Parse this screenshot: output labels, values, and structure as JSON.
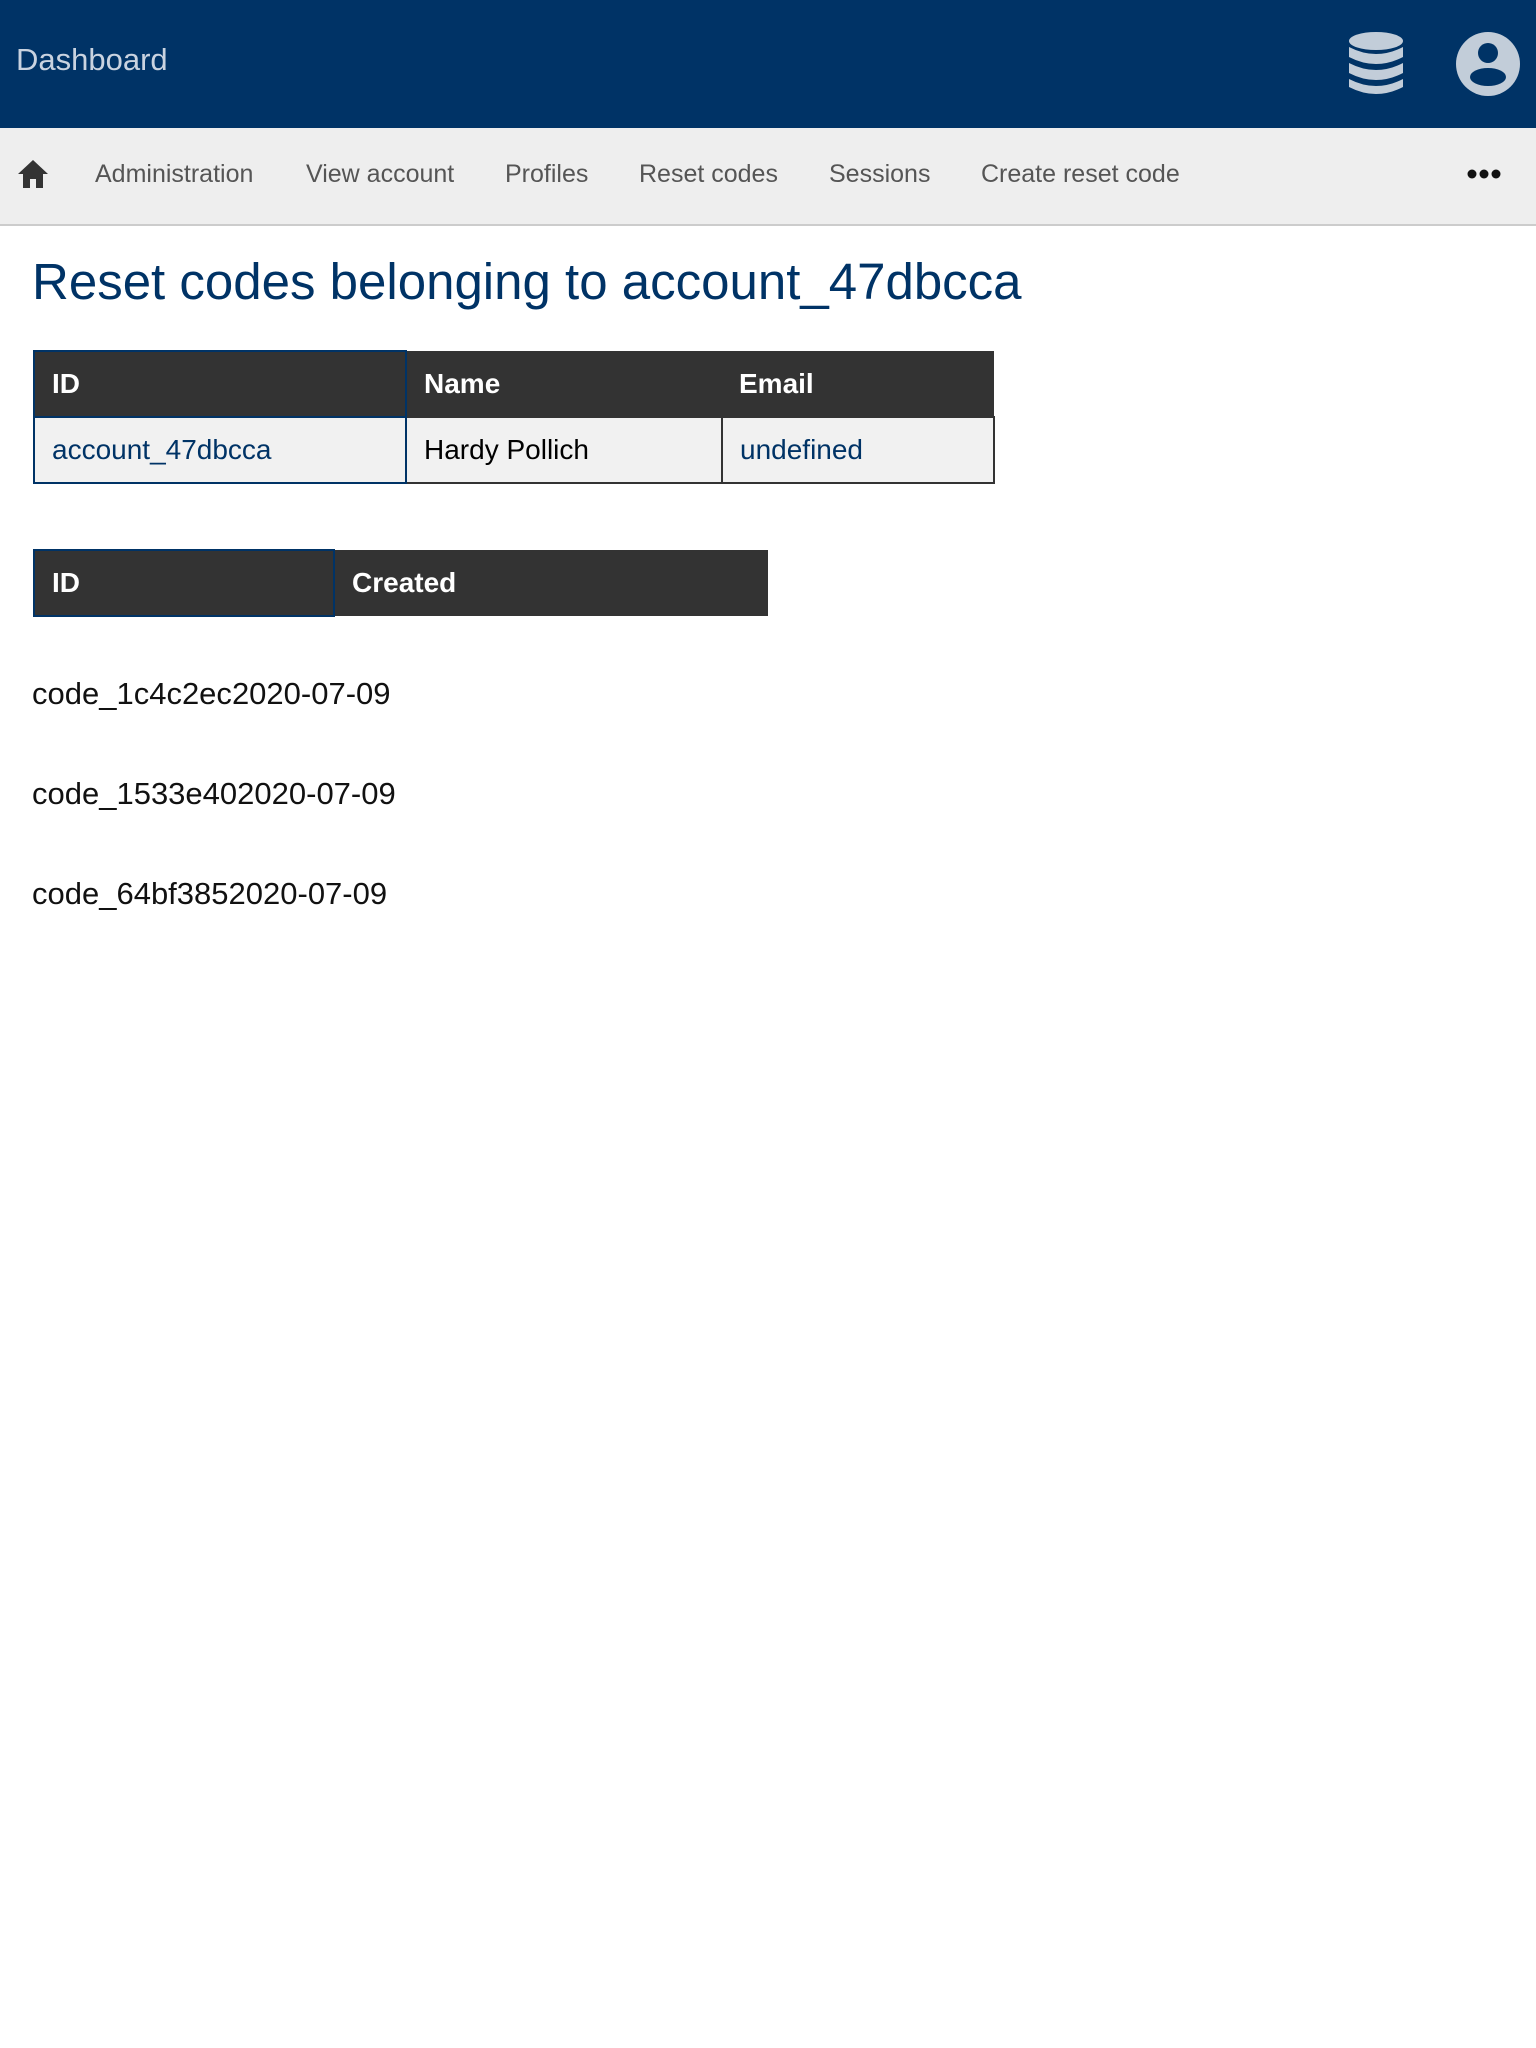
{
  "header": {
    "title": "Dashboard",
    "icons": [
      "database-icon",
      "user-circle-icon"
    ],
    "background": "#003366"
  },
  "nav": {
    "items": [
      {
        "label": "Administration",
        "x": 95
      },
      {
        "label": "View account"
      },
      {
        "label": "Profiles"
      },
      {
        "label": "Reset codes"
      },
      {
        "label": "Sessions"
      },
      {
        "label": "Create reset code"
      }
    ]
  },
  "page": {
    "title": "Reset codes belonging to account_47dbcca"
  },
  "account_table": {
    "headers": [
      "ID",
      "Name",
      "Email"
    ],
    "row": {
      "id": "account_47dbcca",
      "name": "Hardy Pollich",
      "email": "undefined"
    }
  },
  "codes_table": {
    "headers": [
      "ID",
      "Created"
    ]
  },
  "codes": [
    {
      "id": "code_1c4c2ec",
      "created": "2020-07-09"
    },
    {
      "id": "code_1533e40",
      "created": "2020-07-09"
    },
    {
      "id": "code_64bf385",
      "created": "2020-07-09"
    }
  ]
}
